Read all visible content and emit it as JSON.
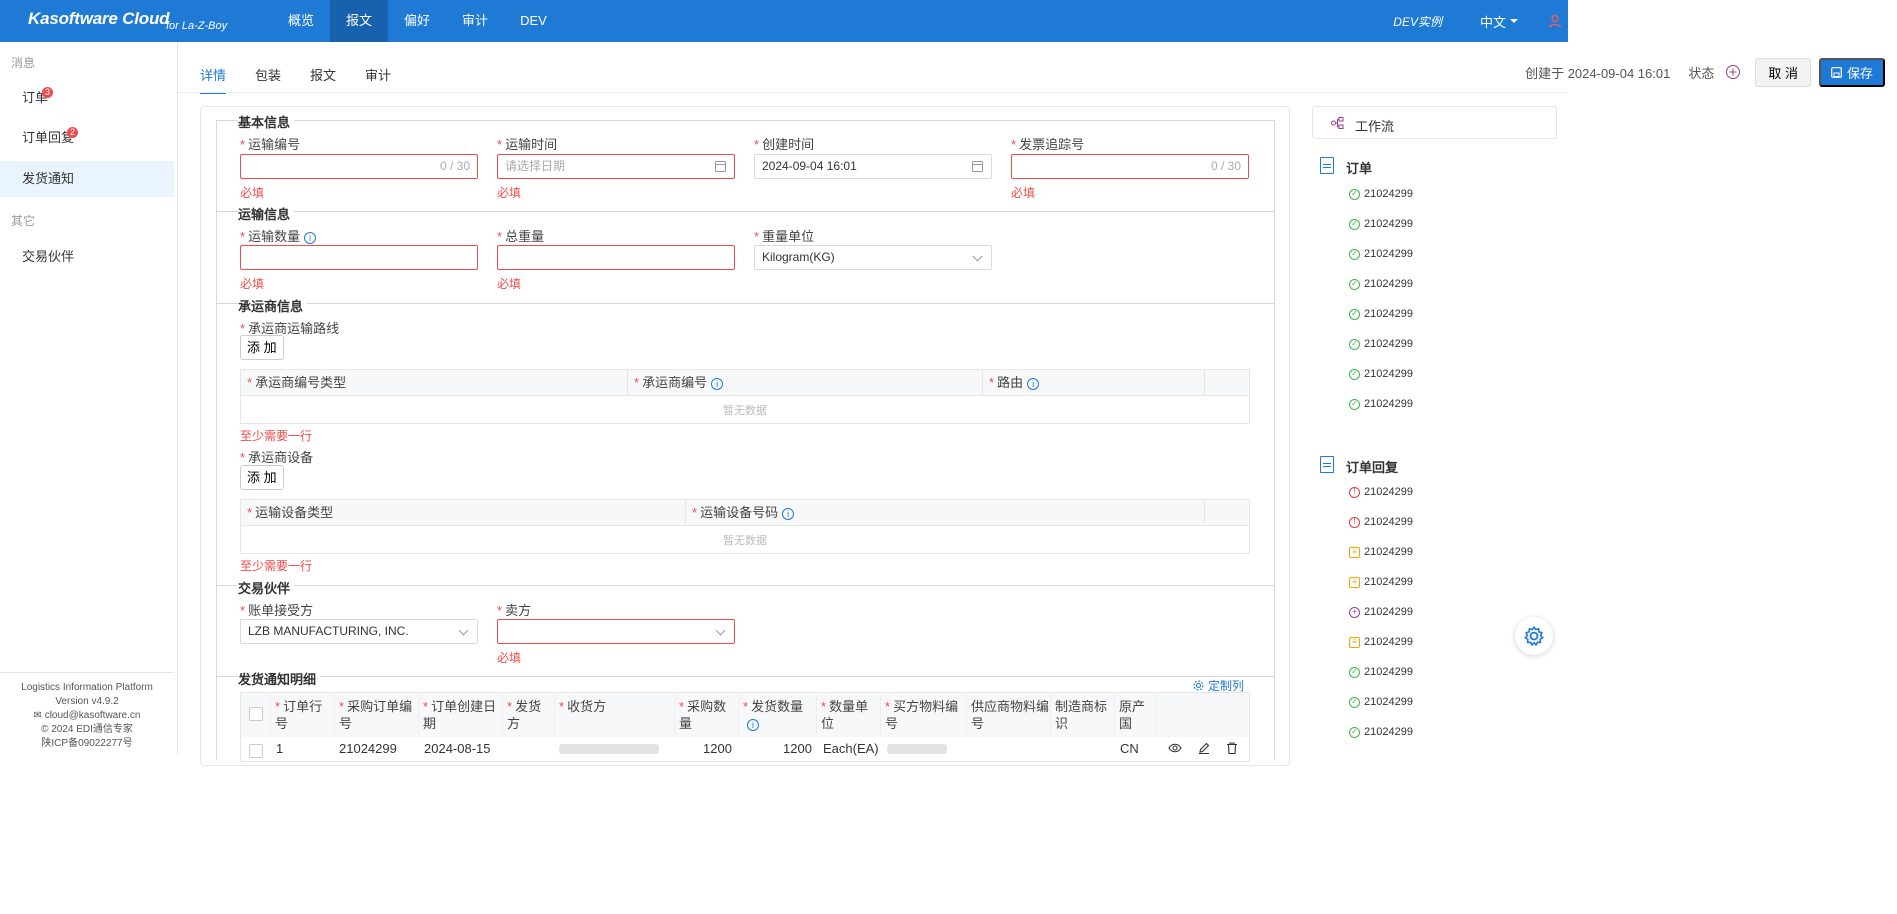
{
  "header": {
    "brand": "Kasoftware Cloud",
    "brand_sub": "for La-Z-Boy",
    "nav": [
      "概览",
      "报文",
      "偏好",
      "审计",
      "DEV"
    ],
    "active_nav": 1,
    "instance": "DEV实例",
    "language": "中文"
  },
  "sidebar": {
    "group1": "消息",
    "items": [
      {
        "label": "订单",
        "badge": "3"
      },
      {
        "label": "订单回复",
        "badge": "2"
      },
      {
        "label": "发货通知",
        "badge": ""
      }
    ],
    "group2": "其它",
    "items2": [
      {
        "label": "交易伙伴"
      }
    ],
    "footer": {
      "platform": "Logistics Information Platform",
      "version": "Version v4.9.2",
      "email": "cloud@kasoftware.cn",
      "copyright": "© 2024 EDI通信专家",
      "icp": "陕ICP备09022277号"
    }
  },
  "tabs": [
    "详情",
    "包装",
    "报文",
    "审计"
  ],
  "toolbar": {
    "created": "创建于 2024-09-04 16:01",
    "status_label": "状态",
    "cancel": "取 消",
    "save": "保存"
  },
  "form": {
    "basic": {
      "legend": "基本信息",
      "shipment_no": {
        "label": "运输编号",
        "counter": "0 / 30",
        "error": "必填"
      },
      "ship_time": {
        "label": "运输时间",
        "placeholder": "请选择日期",
        "error": "必填"
      },
      "create_time": {
        "label": "创建时间",
        "value": "2024-09-04 16:01"
      },
      "invoice_track": {
        "label": "发票追踪号",
        "counter": "0 / 30",
        "error": "必填"
      }
    },
    "transport": {
      "legend": "运输信息",
      "quantity": {
        "label": "运输数量",
        "error": "必填"
      },
      "total_weight": {
        "label": "总重量",
        "error": "必填"
      },
      "weight_unit": {
        "label": "重量单位",
        "value": "Kilogram(KG)"
      }
    },
    "carrier": {
      "legend": "承运商信息",
      "route_label": "承运商运输路线",
      "add": "添 加",
      "route_cols": [
        "承运商编号类型",
        "承运商编号",
        "路由"
      ],
      "empty": "暂无数据",
      "need_row": "至少需要一行",
      "equip_label": "承运商设备",
      "equip_cols": [
        "运输设备类型",
        "运输设备号码"
      ]
    },
    "partners": {
      "legend": "交易伙伴",
      "bill_to": {
        "label": "账单接受方",
        "value": "LZB MANUFACTURING, INC."
      },
      "seller": {
        "label": "卖方",
        "error": "必填"
      }
    },
    "details": {
      "legend": "发货通知明细",
      "customize": "定制列",
      "columns": [
        "订单行号",
        "采购订单编号",
        "订单创建日期",
        "发货方",
        "收货方",
        "采购数量",
        "发货数量",
        "数量单位",
        "买方物料编号",
        "供应商物料编号",
        "制造商标识",
        "原产国"
      ],
      "row": {
        "line": "1",
        "po": "21024299",
        "date": "2024-08-15",
        "qty": "1200",
        "ship_qty": "1200",
        "unit": "Each(EA)",
        "origin": "CN"
      }
    }
  },
  "workflow": {
    "title": "工作流",
    "orders_label": "订单",
    "orders": [
      "21024299",
      "21024299",
      "21024299",
      "21024299",
      "21024299",
      "21024299",
      "21024299",
      "21024299"
    ],
    "replies_label": "订单回复",
    "replies": [
      {
        "id": "21024299",
        "status": "error"
      },
      {
        "id": "21024299",
        "status": "error"
      },
      {
        "id": "21024299",
        "status": "warning"
      },
      {
        "id": "21024299",
        "status": "warning"
      },
      {
        "id": "21024299",
        "status": "pending"
      },
      {
        "id": "21024299",
        "status": "warning"
      },
      {
        "id": "21024299",
        "status": "ok"
      },
      {
        "id": "21024299",
        "status": "ok"
      },
      {
        "id": "21024299",
        "status": "ok"
      }
    ]
  },
  "colors": {
    "primary": "#1f7ad6",
    "error": "#f04b4b",
    "success": "#3bb54a",
    "warning": "#f0a500"
  }
}
